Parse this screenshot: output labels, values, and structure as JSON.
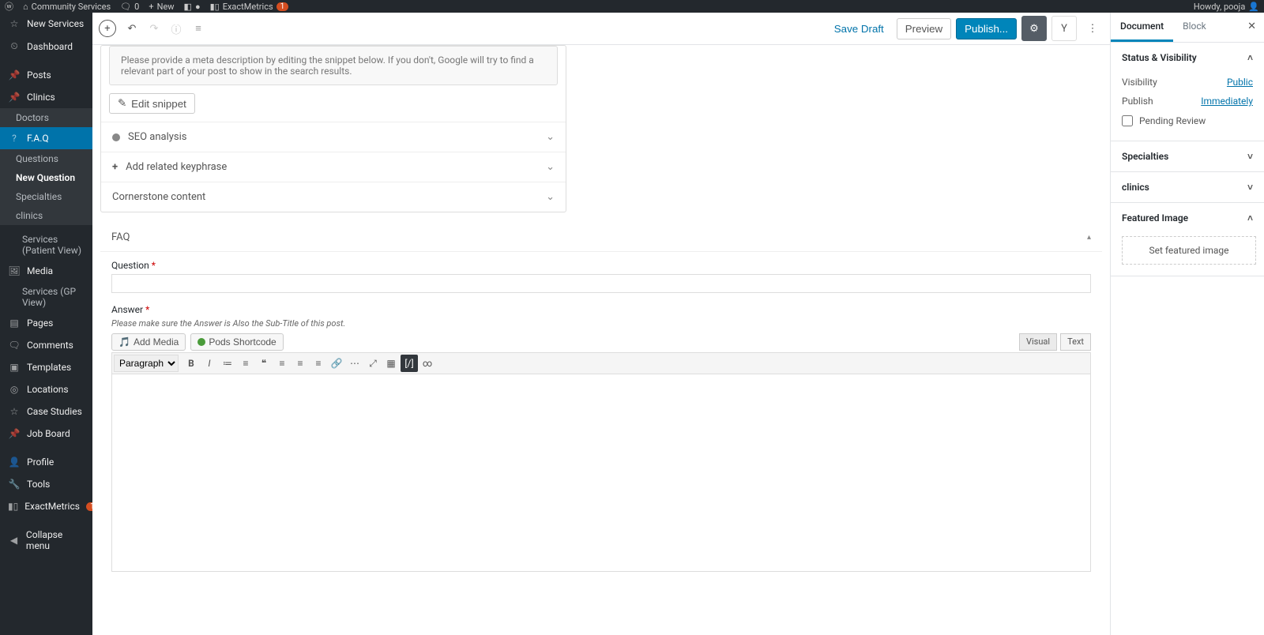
{
  "adminbar": {
    "site_name": "Community Services",
    "comments_count": "0",
    "new_label": "New",
    "exactmetrics": "ExactMetrics",
    "exactmetrics_badge": "1",
    "howdy": "Howdy, pooja"
  },
  "sidebar": {
    "items": [
      {
        "label": "New Services",
        "type": "item"
      },
      {
        "label": "Dashboard",
        "type": "item"
      },
      {
        "label": "Posts",
        "type": "item"
      },
      {
        "label": "Clinics",
        "type": "item"
      },
      {
        "label": "Doctors",
        "type": "sub"
      },
      {
        "label": "F.A.Q",
        "type": "item",
        "current": true
      },
      {
        "label": "Questions",
        "type": "sub"
      },
      {
        "label": "New Question",
        "type": "sub",
        "current": true
      },
      {
        "label": "Specialties",
        "type": "sub"
      },
      {
        "label": "clinics",
        "type": "sub"
      },
      {
        "label": "Services (Patient View)",
        "type": "sub",
        "outside": true
      },
      {
        "label": "Media",
        "type": "item"
      },
      {
        "label": "Services (GP View)",
        "type": "sub",
        "outside": true
      },
      {
        "label": "Pages",
        "type": "item"
      },
      {
        "label": "Comments",
        "type": "item"
      },
      {
        "label": "Templates",
        "type": "item"
      },
      {
        "label": "Locations",
        "type": "item"
      },
      {
        "label": "Case Studies",
        "type": "item"
      },
      {
        "label": "Job Board",
        "type": "item"
      },
      {
        "label": "Profile",
        "type": "item"
      },
      {
        "label": "Tools",
        "type": "item"
      },
      {
        "label": "ExactMetrics",
        "type": "item",
        "badge": "1"
      },
      {
        "label": "Collapse menu",
        "type": "item"
      }
    ]
  },
  "header": {
    "save_draft": "Save Draft",
    "preview": "Preview",
    "publish": "Publish..."
  },
  "yoast": {
    "snippet_desc": "Please provide a meta description by editing the snippet below. If you don't, Google will try to find a relevant part of your post to show in the search results.",
    "edit_snippet": "Edit snippet",
    "seo_analysis": "SEO analysis",
    "add_keyphrase": "Add related keyphrase",
    "cornerstone": "Cornerstone content"
  },
  "faqbox": {
    "title": "FAQ",
    "question_label": "Question",
    "answer_label": "Answer",
    "answer_help": "Please make sure the Answer is Also the Sub-Title of this post.",
    "add_media": "Add Media",
    "pods_shortcode": "Pods Shortcode",
    "tab_visual": "Visual",
    "tab_text": "Text",
    "format_select": "Paragraph"
  },
  "inspector": {
    "tab_document": "Document",
    "tab_block": "Block",
    "status_visibility": "Status & Visibility",
    "visibility_label": "Visibility",
    "visibility_value": "Public",
    "publish_label": "Publish",
    "publish_value": "Immediately",
    "pending_review": "Pending Review",
    "specialties": "Specialties",
    "clinics": "clinics",
    "featured_image": "Featured Image",
    "set_featured": "Set featured image"
  }
}
